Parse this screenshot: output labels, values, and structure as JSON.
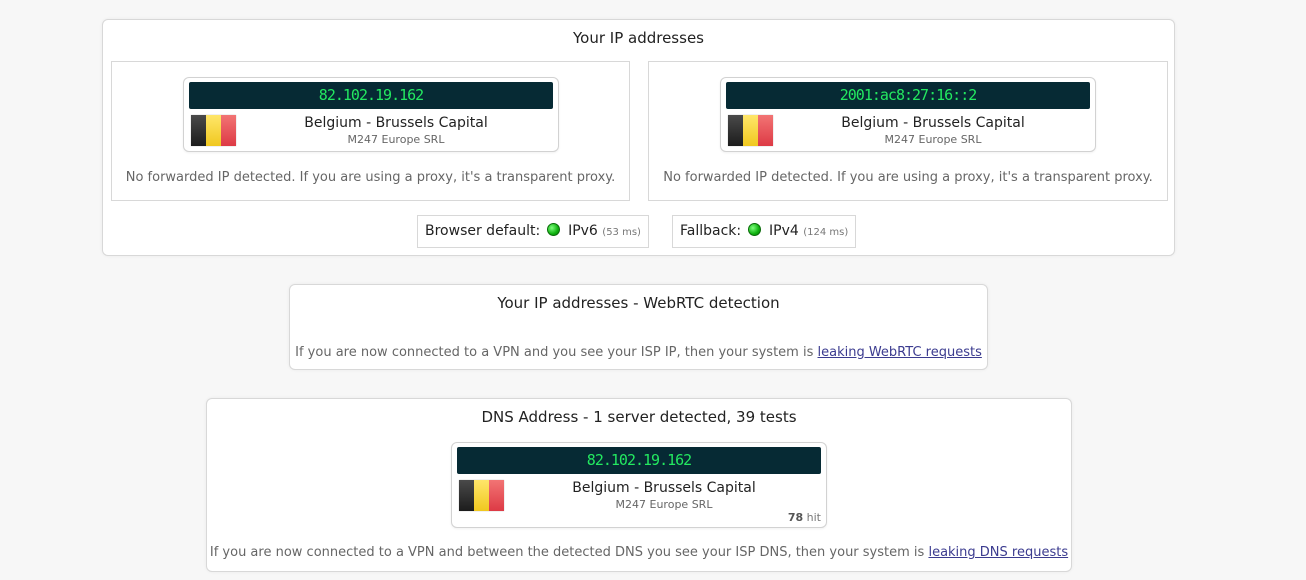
{
  "ip_panel": {
    "title": "Your IP addresses",
    "left": {
      "ip": "82.102.19.162",
      "location": "Belgium - Brussels Capital",
      "isp": "M247 Europe SRL",
      "note": "No forwarded IP detected. If you are using a proxy, it's a transparent proxy."
    },
    "right": {
      "ip": "2001:ac8:27:16::2",
      "location": "Belgium - Brussels Capital",
      "isp": "M247 Europe SRL",
      "note": "No forwarded IP detected. If you are using a proxy, it's a transparent proxy."
    },
    "browser_default": {
      "label": "Browser default:",
      "protocol": "IPv6",
      "latency": "(53 ms)",
      "status_color": "#13b313"
    },
    "fallback": {
      "label": "Fallback:",
      "protocol": "IPv4",
      "latency": "(124 ms)",
      "status_color": "#13b313"
    }
  },
  "webrtc_panel": {
    "title": "Your IP addresses - WebRTC detection",
    "note_prefix": "If you are now connected to a VPN and you see your ISP IP, then your system is",
    "link": "leaking WebRTC requests"
  },
  "dns_panel": {
    "title": "DNS Address - 1 server detected, 39 tests",
    "card": {
      "ip": "82.102.19.162",
      "location": "Belgium - Brussels Capital",
      "isp": "M247 Europe SRL",
      "hits": "78",
      "hits_label": "hit"
    },
    "note_prefix": "If you are now connected to a VPN and between the detected DNS you see your ISP DNS, then your system is",
    "link": "leaking DNS requests"
  },
  "flag": {
    "country": "Belgium",
    "colors": [
      "#2b2b2b",
      "#f6d431",
      "#e84a53"
    ]
  }
}
